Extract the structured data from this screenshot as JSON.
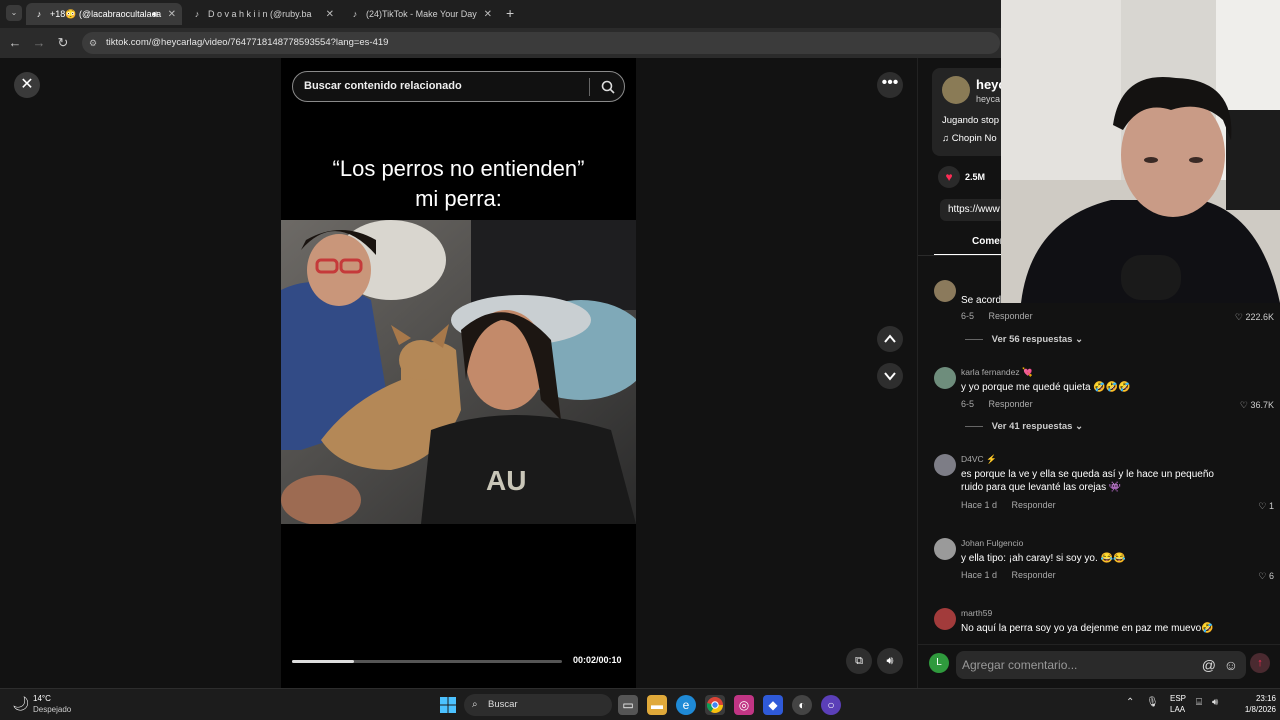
{
  "browser": {
    "tabs": [
      {
        "label": "+18😳 (@lacabraocultalaca",
        "icon": "tiktok-icon",
        "active": true
      },
      {
        "label": "D o v a h k i i n (@ruby.ba",
        "icon": "tiktok-icon",
        "active": false
      },
      {
        "label": "(24)TikTok - Make Your Day",
        "icon": "tiktok-icon",
        "active": false
      }
    ],
    "new_tab": "+",
    "url": "tiktok.com/@heycarlag/video/7647718148778593554?lang=es-419"
  },
  "video": {
    "search_placeholder": "Buscar contenido relacionado",
    "caption_line1": "“Los perros no entienden”",
    "caption_line2": "mi perra:",
    "time": "00:02/00:10",
    "progress_fraction": 0.23
  },
  "panel": {
    "author_name": "heyc",
    "author_handle": "heyca",
    "description": "Jugando stop",
    "music": "Chopin No",
    "likes": "2.5M",
    "link": "https://www",
    "tab_label": "Comen",
    "comments": [
      {
        "user": "",
        "text": "Se acord",
        "date": "6-5",
        "reply": "Responder",
        "likes": "222.6K",
        "replies": "Ver 56 respuestas"
      },
      {
        "user": "karla fernandez 💘",
        "text": "y yo porque me quedé quieta 🤣🤣🤣",
        "date": "6-5",
        "reply": "Responder",
        "likes": "36.7K",
        "replies": "Ver 41 respuestas"
      },
      {
        "user": "D4VC ⚡",
        "text": "es porque la ve y ella se queda así y le hace un pequeño ruido para que levanté las orejas 👾",
        "date": "Hace 1 d",
        "reply": "Responder",
        "likes": "1"
      },
      {
        "user": "Johan Fulgencio",
        "text": "y ella tipo: ¡ah caray! si soy yo. 😂😂",
        "date": "Hace 1 d",
        "reply": "Responder",
        "likes": "6"
      },
      {
        "user": "marth59",
        "text": "No aquí la perra soy yo ya dejenme en paz me muevo🤣"
      }
    ],
    "composer_placeholder": "Agregar comentario...",
    "composer_avatar": "L"
  },
  "taskbar": {
    "temp": "14°C",
    "weather": "Despejado",
    "search": "Buscar",
    "lang1": "ESP",
    "lang2": "LAA",
    "clock_time": "23:16",
    "clock_date": "1/8/2026"
  },
  "colors": {
    "tiktok_red": "#fe2c55",
    "composer_avatar": "#2f9a3d"
  }
}
